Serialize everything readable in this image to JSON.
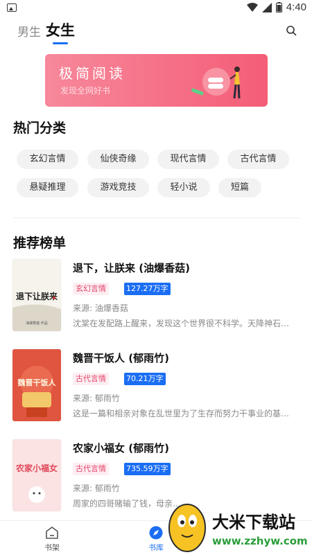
{
  "status_bar": {
    "time": "4:40"
  },
  "nav": {
    "tab_male": "男生",
    "tab_female": "女生",
    "search_icon": "search-icon"
  },
  "banner": {
    "title": "极简阅读",
    "subtitle": "发现全网好书"
  },
  "hot_categories": {
    "title": "热门分类",
    "items": [
      "玄幻言情",
      "仙侠奇缘",
      "现代言情",
      "古代言情",
      "悬疑推理",
      "游戏竞技",
      "轻小说",
      "短篇"
    ]
  },
  "ranking": {
    "title": "推荐榜单",
    "books": [
      {
        "title": "退下，让朕来 (油爆香菇)",
        "category": "玄幻言情",
        "words": "127.27万字",
        "source": "来源: 油爆香菇",
        "desc": "沈棠在发配路上醒来，发现这个世界很不科学。天降神石…",
        "cover_text": "退下让朕来",
        "cover_author": "油爆香菇  作品"
      },
      {
        "title": "魏晋干饭人 (郁雨竹)",
        "category": "古代言情",
        "words": "70.21万字",
        "source": "来源: 郁雨竹",
        "desc": "这是一篇和相亲对象在乱世里为了生存而努力干事业的基…",
        "cover_text": "魏晋干饭人"
      },
      {
        "title": "农家小福女 (郁雨竹)",
        "category": "古代言情",
        "words": "735.59万字",
        "source": "来源: 郁雨竹",
        "desc": "周家的四哥赌输了钱，母亲…",
        "cover_text": "农家小福女"
      }
    ]
  },
  "bottom_nav": {
    "shelf": "书架",
    "store": "书库"
  },
  "watermark": {
    "name": "大米下载站",
    "url": "www.zzhyw.com"
  },
  "colors": {
    "accent": "#1b6ef3",
    "banner": "#f45d77",
    "tag_pink": "#e6436a"
  }
}
